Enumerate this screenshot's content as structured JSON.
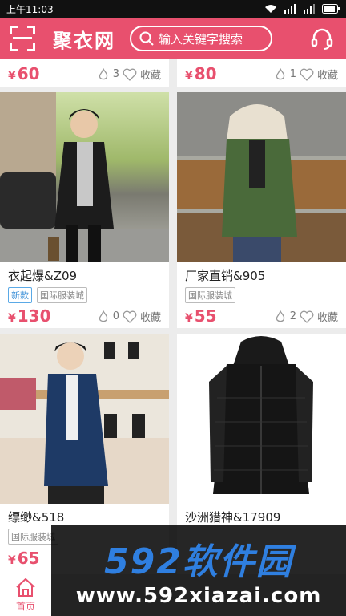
{
  "status_bar": {
    "time": "上午11:03",
    "icons": [
      "wifi-icon",
      "signal-icon",
      "signal-icon",
      "battery-icon"
    ]
  },
  "header": {
    "title": "聚衣网",
    "search_placeholder": "输入关键字搜索",
    "scan_icon": "scan-icon",
    "service_icon": "headset-icon"
  },
  "colors": {
    "brand": "#e8506e",
    "price": "#e8506e",
    "new_tag": "#3a8fd8"
  },
  "top_row": [
    {
      "price": "60",
      "likes": "3",
      "fav": "收藏"
    },
    {
      "price": "80",
      "likes": "1",
      "fav": "收藏"
    }
  ],
  "products": [
    {
      "name": "衣起爆&Z09",
      "tags": [
        "新款",
        "国际服装城"
      ],
      "price": "130",
      "likes": "0",
      "fav": "收藏"
    },
    {
      "name": "厂家直销&905",
      "tags": [
        "国际服装城"
      ],
      "price": "55",
      "likes": "2",
      "fav": "收藏"
    },
    {
      "name": "缥缈&518",
      "tags": [
        "国际服装城"
      ],
      "price": "65",
      "likes": "",
      "fav": ""
    },
    {
      "name": "沙洲猎神&17909",
      "tags": [],
      "price": "",
      "likes": "",
      "fav": ""
    }
  ],
  "currency": "¥",
  "bottom_nav": {
    "home_label": "首页",
    "home_icon": "home-icon"
  },
  "watermark": {
    "brand": "592软件园",
    "url": "www.592xiazai.com"
  }
}
